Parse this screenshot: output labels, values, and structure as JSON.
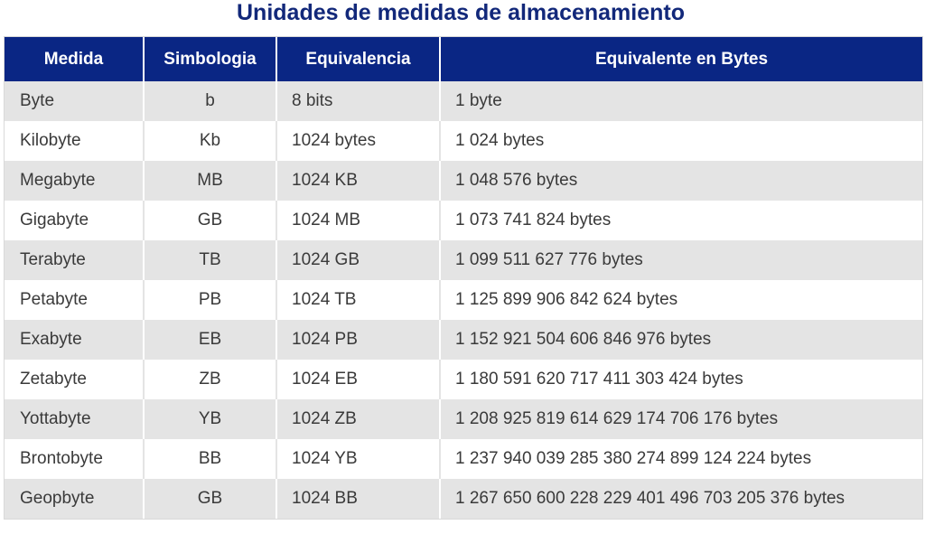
{
  "title": "Unidades de medidas de almacenamiento",
  "headers": {
    "measure": "Medida",
    "symbol": "Simbologia",
    "equivalence": "Equivalencia",
    "bytes": "Equivalente en Bytes"
  },
  "rows": [
    {
      "measure": "Byte",
      "symbol": "b",
      "equivalence": "8 bits",
      "bytes": "1 byte"
    },
    {
      "measure": "Kilobyte",
      "symbol": "Kb",
      "equivalence": "1024 bytes",
      "bytes": "1 024 bytes"
    },
    {
      "measure": "Megabyte",
      "symbol": "MB",
      "equivalence": "1024 KB",
      "bytes": "1 048 576 bytes"
    },
    {
      "measure": "Gigabyte",
      "symbol": "GB",
      "equivalence": "1024 MB",
      "bytes": "1 073 741 824 bytes"
    },
    {
      "measure": "Terabyte",
      "symbol": "TB",
      "equivalence": "1024 GB",
      "bytes": "1 099 511 627 776 bytes"
    },
    {
      "measure": "Petabyte",
      "symbol": "PB",
      "equivalence": "1024 TB",
      "bytes": "1 125 899 906 842 624 bytes"
    },
    {
      "measure": "Exabyte",
      "symbol": "EB",
      "equivalence": "1024 PB",
      "bytes": "1 152 921 504 606 846 976 bytes"
    },
    {
      "measure": "Zetabyte",
      "symbol": "ZB",
      "equivalence": "1024 EB",
      "bytes": "1 180 591 620 717 411 303 424 bytes"
    },
    {
      "measure": "Yottabyte",
      "symbol": "YB",
      "equivalence": "1024 ZB",
      "bytes": "1 208 925 819 614 629 174 706 176 bytes"
    },
    {
      "measure": "Brontobyte",
      "symbol": "BB",
      "equivalence": "1024 YB",
      "bytes": "1 237 940 039 285 380 274 899 124 224 bytes"
    },
    {
      "measure": "Geopbyte",
      "symbol": "GB",
      "equivalence": "1024 BB",
      "bytes": "1 267 650 600 228 229 401 496 703 205 376 bytes"
    }
  ],
  "colors": {
    "title": "#12287a",
    "header_bg": "#0a2684",
    "header_text": "#ffffff",
    "stripe": "#e4e4e4",
    "cell_text": "#3a3a3a"
  }
}
